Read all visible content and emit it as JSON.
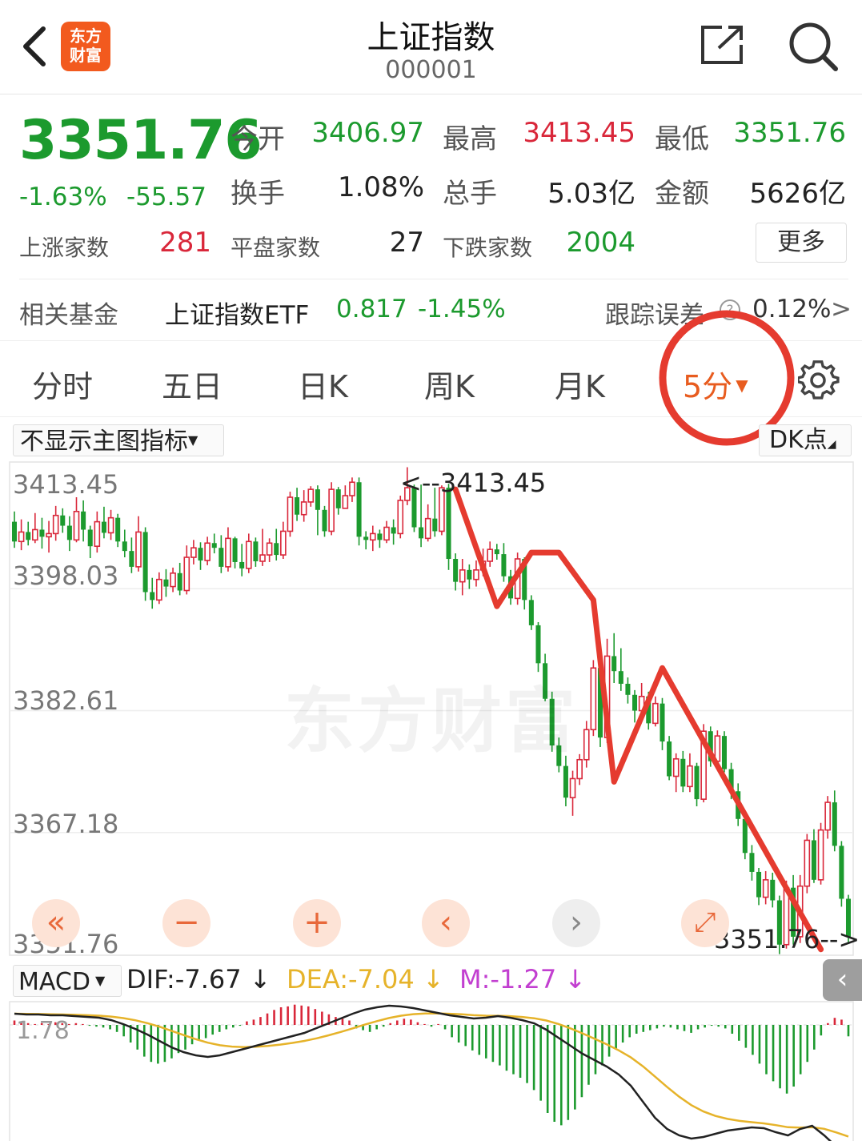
{
  "header": {
    "title": "上证指数",
    "code": "000001",
    "logo_top": "东方",
    "logo_bottom": "财富"
  },
  "quote": {
    "price": "3351.76",
    "change_pct": "-1.63%",
    "change": "-55.57",
    "open_label": "今开",
    "open": "3406.97",
    "high_label": "最高",
    "high": "3413.45",
    "low_label": "最低",
    "low": "3351.76",
    "turnover_label": "换手",
    "turnover": "1.08%",
    "volume_label": "总手",
    "volume": "5.03亿",
    "amount_label": "金额",
    "amount": "5626亿",
    "up_label": "上涨家数",
    "up": "281",
    "flat_label": "平盘家数",
    "flat": "27",
    "down_label": "下跌家数",
    "down": "2004",
    "more_label": "更多"
  },
  "fund": {
    "label": "相关基金",
    "name": "上证指数ETF",
    "price": "0.817",
    "change": "-1.45%",
    "track_label": "跟踪误差",
    "track_value": "0.12%",
    "arrow": ">"
  },
  "tabs": [
    {
      "label": "分时"
    },
    {
      "label": "五日"
    },
    {
      "label": "日K"
    },
    {
      "label": "周K"
    },
    {
      "label": "月K"
    },
    {
      "label": "5分",
      "active": true
    }
  ],
  "indicator": {
    "main": "不显示主图指标",
    "dk": "DK点"
  },
  "chart_data": {
    "type": "candlestick",
    "y_ticks": [
      "3413.45",
      "3398.03",
      "3382.61",
      "3367.18",
      "3351.76"
    ],
    "ylim": [
      3351.76,
      3413.45
    ],
    "high_marker": "<--3413.45",
    "low_marker": "3351.76-->",
    "watermark": "东方财富",
    "candles": [
      [
        3406.5,
        3404.0,
        3407.8,
        3403.2
      ],
      [
        3404.0,
        3405.2,
        3406.8,
        3402.9
      ],
      [
        3405.2,
        3404.2,
        3406.5,
        3403.5
      ],
      [
        3404.2,
        3405.5,
        3407.6,
        3403.8
      ],
      [
        3405.5,
        3404.6,
        3407.0,
        3403.1
      ],
      [
        3404.6,
        3405.0,
        3406.6,
        3402.6
      ],
      [
        3405.0,
        3407.3,
        3408.5,
        3404.1
      ],
      [
        3407.3,
        3406.0,
        3408.2,
        3405.1
      ],
      [
        3406.0,
        3404.2,
        3407.2,
        3402.8
      ],
      [
        3404.2,
        3407.8,
        3409.6,
        3403.9
      ],
      [
        3407.8,
        3405.5,
        3409.2,
        3404.0
      ],
      [
        3405.5,
        3403.4,
        3406.0,
        3401.9
      ],
      [
        3403.4,
        3406.5,
        3407.8,
        3402.6
      ],
      [
        3406.5,
        3405.1,
        3408.4,
        3404.4
      ],
      [
        3405.1,
        3407.0,
        3408.0,
        3404.2
      ],
      [
        3407.0,
        3404.0,
        3407.5,
        3403.3
      ],
      [
        3404.0,
        3402.8,
        3405.5,
        3402.0
      ],
      [
        3402.8,
        3400.8,
        3404.5,
        3400.0
      ],
      [
        3400.8,
        3405.2,
        3407.2,
        3400.2
      ],
      [
        3405.2,
        3397.6,
        3405.8,
        3396.5
      ],
      [
        3397.6,
        3396.6,
        3399.4,
        3395.5
      ],
      [
        3396.6,
        3399.2,
        3400.1,
        3396.1
      ],
      [
        3399.2,
        3398.3,
        3400.5,
        3397.0
      ],
      [
        3398.3,
        3400.0,
        3400.7,
        3397.6
      ],
      [
        3400.0,
        3397.8,
        3401.3,
        3397.2
      ],
      [
        3397.8,
        3402.0,
        3403.5,
        3397.3
      ],
      [
        3402.0,
        3403.2,
        3404.2,
        3401.1
      ],
      [
        3403.2,
        3401.6,
        3403.9,
        3400.4
      ],
      [
        3401.6,
        3403.8,
        3404.6,
        3401.0
      ],
      [
        3403.8,
        3403.2,
        3405.0,
        3402.5
      ],
      [
        3403.2,
        3400.8,
        3404.8,
        3400.0
      ],
      [
        3400.8,
        3404.4,
        3405.8,
        3400.2
      ],
      [
        3404.4,
        3401.4,
        3404.6,
        3400.6
      ],
      [
        3401.4,
        3400.6,
        3403.7,
        3399.6
      ],
      [
        3400.6,
        3404.0,
        3405.0,
        3400.0
      ],
      [
        3404.0,
        3401.5,
        3404.5,
        3400.8
      ],
      [
        3401.5,
        3402.3,
        3405.6,
        3400.9
      ],
      [
        3402.3,
        3403.8,
        3404.4,
        3401.4
      ],
      [
        3403.8,
        3402.3,
        3405.6,
        3401.6
      ],
      [
        3402.3,
        3405.3,
        3406.5,
        3401.8
      ],
      [
        3405.3,
        3409.6,
        3410.3,
        3404.6
      ],
      [
        3409.6,
        3407.4,
        3410.8,
        3406.6
      ],
      [
        3407.4,
        3409.0,
        3410.5,
        3406.5
      ],
      [
        3409.0,
        3410.6,
        3411.0,
        3408.4
      ],
      [
        3410.6,
        3408.0,
        3411.1,
        3404.8
      ],
      [
        3408.0,
        3405.3,
        3408.5,
        3404.6
      ],
      [
        3405.3,
        3410.6,
        3411.5,
        3404.8
      ],
      [
        3410.6,
        3408.2,
        3410.9,
        3407.4
      ],
      [
        3408.2,
        3409.8,
        3411.1,
        3408.8
      ],
      [
        3409.8,
        3411.5,
        3412.1,
        3409.0
      ],
      [
        3411.5,
        3404.6,
        3412.1,
        3403.5
      ],
      [
        3404.6,
        3404.2,
        3405.3,
        3403.0
      ],
      [
        3404.2,
        3405.0,
        3406.0,
        3402.8
      ],
      [
        3405.0,
        3404.2,
        3405.5,
        3403.2
      ],
      [
        3404.2,
        3405.8,
        3406.6,
        3403.8
      ],
      [
        3405.8,
        3405.0,
        3406.8,
        3403.6
      ],
      [
        3405.0,
        3409.2,
        3409.8,
        3404.4
      ],
      [
        3409.2,
        3410.8,
        3413.4,
        3408.6
      ],
      [
        3410.8,
        3405.8,
        3411.2,
        3405.2
      ],
      [
        3405.8,
        3404.4,
        3411.2,
        3403.3
      ],
      [
        3404.4,
        3406.9,
        3408.7,
        3404.0
      ],
      [
        3406.9,
        3405.3,
        3410.8,
        3404.6
      ],
      [
        3405.3,
        3410.8,
        3411.1,
        3404.8
      ],
      [
        3410.8,
        3401.8,
        3411.3,
        3400.4
      ],
      [
        3401.8,
        3398.9,
        3402.5,
        3397.8
      ],
      [
        3398.9,
        3400.4,
        3401.8,
        3397.2
      ],
      [
        3400.4,
        3399.2,
        3401.1,
        3398.0
      ],
      [
        3399.2,
        3400.4,
        3401.6,
        3398.3
      ],
      [
        3400.4,
        3401.5,
        3403.1,
        3399.6
      ],
      [
        3401.5,
        3403.0,
        3404.0,
        3400.8
      ],
      [
        3403.0,
        3402.4,
        3403.7,
        3401.7
      ],
      [
        3402.4,
        3399.6,
        3403.8,
        3398.9
      ],
      [
        3399.6,
        3396.8,
        3400.4,
        3396.0
      ],
      [
        3396.8,
        3401.8,
        3402.6,
        3396.0
      ],
      [
        3401.8,
        3396.6,
        3402.0,
        3395.4
      ],
      [
        3396.6,
        3393.4,
        3397.2,
        3392.8
      ],
      [
        3393.4,
        3388.6,
        3393.8,
        3387.5
      ],
      [
        3388.6,
        3384.1,
        3389.8,
        3383.8
      ],
      [
        3384.1,
        3378.2,
        3385.0,
        3377.4
      ],
      [
        3378.2,
        3375.6,
        3379.2,
        3374.8
      ],
      [
        3375.6,
        3371.6,
        3376.9,
        3370.5
      ],
      [
        3371.6,
        3374.0,
        3375.0,
        3369.3
      ],
      [
        3374.0,
        3376.4,
        3377.1,
        3373.2
      ],
      [
        3376.4,
        3380.2,
        3381.3,
        3375.4
      ],
      [
        3380.2,
        3388.0,
        3389.0,
        3379.4
      ],
      [
        3388.0,
        3379.2,
        3388.8,
        3378.0
      ],
      [
        3379.2,
        3389.5,
        3391.7,
        3378.5
      ],
      [
        3389.5,
        3387.6,
        3392.4,
        3386.1
      ],
      [
        3387.6,
        3386.0,
        3390.5,
        3385.1
      ],
      [
        3386.0,
        3384.6,
        3386.8,
        3383.5
      ],
      [
        3384.6,
        3382.6,
        3385.2,
        3381.1
      ],
      [
        3382.6,
        3384.4,
        3386.1,
        3381.5
      ],
      [
        3384.4,
        3381.0,
        3385.0,
        3380.2
      ],
      [
        3381.0,
        3383.5,
        3384.4,
        3380.6
      ],
      [
        3383.5,
        3378.7,
        3384.2,
        3377.6
      ],
      [
        3378.7,
        3374.3,
        3379.4,
        3373.8
      ],
      [
        3374.3,
        3376.5,
        3377.2,
        3372.3
      ],
      [
        3376.5,
        3373.0,
        3377.5,
        3372.3
      ],
      [
        3373.0,
        3375.6,
        3377.2,
        3372.3
      ],
      [
        3375.6,
        3371.4,
        3376.0,
        3370.5
      ],
      [
        3371.4,
        3380.0,
        3380.9,
        3371.0
      ],
      [
        3380.0,
        3376.2,
        3380.6,
        3375.5
      ],
      [
        3376.2,
        3379.4,
        3380.1,
        3375.6
      ],
      [
        3379.4,
        3375.2,
        3380.0,
        3374.8
      ],
      [
        3375.2,
        3372.4,
        3376.0,
        3371.4
      ],
      [
        3372.4,
        3368.9,
        3373.4,
        3368.0
      ],
      [
        3368.9,
        3364.6,
        3369.4,
        3363.8
      ],
      [
        3364.6,
        3362.2,
        3365.6,
        3361.1
      ],
      [
        3362.2,
        3359.0,
        3362.7,
        3358.0
      ],
      [
        3359.0,
        3361.2,
        3362.3,
        3358.1
      ],
      [
        3361.2,
        3358.6,
        3362.1,
        3357.7
      ],
      [
        3358.6,
        3353.0,
        3359.2,
        3351.8
      ],
      [
        3353.0,
        3360.2,
        3361.1,
        3352.5
      ],
      [
        3360.2,
        3354.0,
        3361.8,
        3353.0
      ],
      [
        3354.0,
        3360.4,
        3361.8,
        3353.2
      ],
      [
        3360.4,
        3366.2,
        3367.0,
        3359.5
      ],
      [
        3366.2,
        3361.2,
        3367.6,
        3360.8
      ],
      [
        3361.2,
        3367.5,
        3368.4,
        3360.6
      ],
      [
        3367.5,
        3371.0,
        3371.8,
        3366.4
      ],
      [
        3371.0,
        3365.5,
        3372.5,
        3364.8
      ],
      [
        3365.5,
        3358.8,
        3366.1,
        3357.8
      ],
      [
        3358.8,
        3354.0,
        3359.3,
        3353.1
      ]
    ]
  },
  "controls": {
    "first": "«",
    "minus": "−",
    "plus": "+",
    "prev": "‹",
    "next": "›",
    "expand": "⤢"
  },
  "macd": {
    "label": "MACD",
    "dif": "DIF:-7.67",
    "dea": "DEA:-7.04",
    "m": "M:-1.27",
    "arrow": "↓",
    "ytick": "1.78",
    "side_tab": "‹",
    "hist": [
      0.5,
      0.3,
      0.2,
      0.1,
      0.2,
      0.1,
      0.3,
      0.2,
      0.1,
      0.2,
      0.1,
      -0.1,
      -0.2,
      -0.3,
      -0.5,
      -0.8,
      -1.3,
      -2.0,
      -2.8,
      -3.6,
      -4.2,
      -4.4,
      -4.2,
      -3.8,
      -3.2,
      -2.8,
      -2.2,
      -1.8,
      -1.5,
      -1.1,
      -0.8,
      -0.5,
      -0.3,
      -0.1,
      0.4,
      0.6,
      0.9,
      1.3,
      1.7,
      2.0,
      2.1,
      2.3,
      2.2,
      2.1,
      1.8,
      1.5,
      1.2,
      0.9,
      0.7,
      0.5,
      -0.4,
      -0.6,
      -0.8,
      -0.5,
      -0.2,
      0.2,
      0.5,
      0.7,
      0.6,
      0.3,
      0.1,
      -0.2,
      0.1,
      -0.5,
      -1.4,
      -2.0,
      -2.4,
      -2.9,
      -3.4,
      -3.8,
      -4.2,
      -4.6,
      -5.2,
      -5.6,
      -6.0,
      -6.6,
      -7.4,
      -8.6,
      -10.0,
      -11.0,
      -11.4,
      -10.8,
      -9.6,
      -8.2,
      -6.8,
      -5.6,
      -4.6,
      -3.6,
      -2.8,
      -2.0,
      -1.4,
      -1.0,
      -0.8,
      -0.6,
      -0.4,
      -0.2,
      -0.3,
      -0.5,
      -0.7,
      -0.9,
      -0.5,
      -0.3,
      -0.1,
      -0.2,
      -0.4,
      -1.0,
      -1.8,
      -2.6,
      -3.4,
      -4.4,
      -5.6,
      -6.4,
      -7.2,
      -7.8,
      -7.0,
      -5.6,
      -4.2,
      -2.8,
      -1.2,
      0.2,
      0.8,
      0.6,
      -1.3
    ],
    "dif_line": [
      1.4,
      1.3,
      1.3,
      1.2,
      1.2,
      1.1,
      1.0,
      0.9,
      0.6,
      0.1,
      -0.5,
      -1.2,
      -2.0,
      -2.8,
      -3.4,
      -3.8,
      -4.0,
      -3.8,
      -3.4,
      -3.0,
      -2.6,
      -2.2,
      -1.8,
      -1.4,
      -1.0,
      -0.4,
      0.2,
      0.8,
      1.4,
      1.9,
      2.2,
      2.4,
      2.3,
      2.1,
      1.8,
      1.5,
      1.2,
      1.0,
      0.8,
      0.9,
      1.1,
      0.9,
      0.6,
      0.2,
      -0.6,
      -1.6,
      -2.6,
      -3.6,
      -4.4,
      -5.2,
      -6.2,
      -7.6,
      -9.6,
      -11.6,
      -13.0,
      -13.8,
      -14.2,
      -14.0,
      -13.6,
      -13.2,
      -13.0,
      -12.8,
      -12.9,
      -13.4,
      -13.8,
      -13.0,
      -12.6,
      -13.8,
      -15.2,
      -16.0
    ]
  }
}
